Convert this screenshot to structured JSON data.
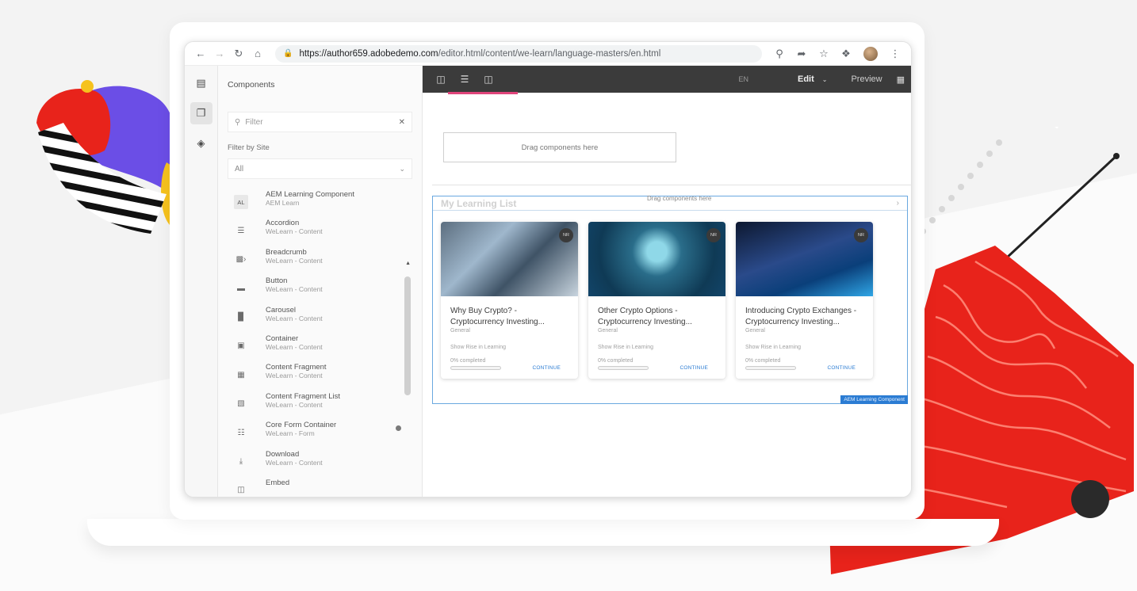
{
  "browser": {
    "url_host": "https://author659.adobedemo.com",
    "url_path": "/editor.html/content/we-learn/language-masters/en.html"
  },
  "panel": {
    "title": "Components",
    "filter_placeholder": "Filter",
    "filter_by_site_label": "Filter by Site",
    "site_selected": "All",
    "items": [
      {
        "name": "AEM Learning Component",
        "group": "AEM Learn",
        "icon": "AL"
      },
      {
        "name": "Accordion",
        "group": "WeLearn - Content",
        "icon": "accordion-icon"
      },
      {
        "name": "Breadcrumb",
        "group": "WeLearn - Content",
        "icon": "breadcrumb-icon"
      },
      {
        "name": "Button",
        "group": "WeLearn - Content",
        "icon": "button-icon"
      },
      {
        "name": "Carousel",
        "group": "WeLearn - Content",
        "icon": "carousel-icon"
      },
      {
        "name": "Container",
        "group": "WeLearn - Content",
        "icon": "container-icon"
      },
      {
        "name": "Content Fragment",
        "group": "WeLearn - Content",
        "icon": "content-fragment-icon"
      },
      {
        "name": "Content Fragment List",
        "group": "WeLearn - Content",
        "icon": "content-fragment-list-icon"
      },
      {
        "name": "Core Form Container",
        "group": "WeLearn - Form",
        "icon": "form-container-icon"
      },
      {
        "name": "Download",
        "group": "WeLearn - Content",
        "icon": "download-icon"
      },
      {
        "name": "Embed",
        "group": "",
        "icon": "embed-icon"
      }
    ]
  },
  "toolbar": {
    "language": "EN",
    "mode": "Edit",
    "preview": "Preview"
  },
  "editor": {
    "drop_zone_text": "Drag components here",
    "learning_component": {
      "title": "My Learning List",
      "drag_text": "Drag components here",
      "tag": "AEM Learning Component",
      "cards": [
        {
          "title": "Why Buy Crypto? - Cryptocurrency Investing...",
          "type": "General",
          "skill": "Show Rise in Learning",
          "progress_label": "0% completed",
          "progress": 0,
          "action": "CONTINUE",
          "badge": "NR"
        },
        {
          "title": "Other Crypto Options - Cryptocurrency Investing...",
          "type": "General",
          "skill": "Show Rise in Learning",
          "progress_label": "0% completed",
          "progress": 0,
          "action": "CONTINUE",
          "badge": "NR"
        },
        {
          "title": "Introducing Crypto Exchanges - Cryptocurrency Investing...",
          "type": "General",
          "skill": "Show Rise in Learning",
          "progress_label": "0% completed",
          "progress": 0,
          "action": "CONTINUE",
          "badge": "NR"
        }
      ]
    }
  },
  "colors": {
    "accent_blue": "#2b7cd3",
    "toolbar_dark": "#3b3b3b",
    "active_tab_pink": "#e0457b",
    "deco_red": "#e8231b",
    "deco_purple": "#6b4ee6",
    "deco_yellow": "#f6c21d"
  }
}
